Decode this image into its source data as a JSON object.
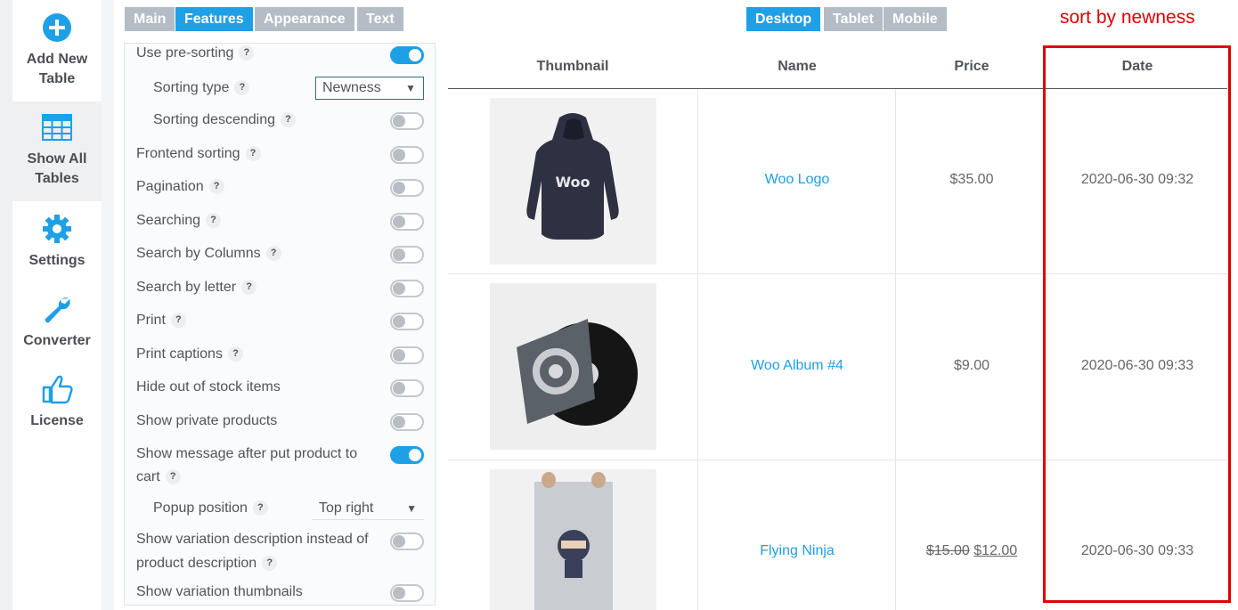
{
  "sidebar": {
    "items": [
      {
        "label": "Add New\nTable",
        "icon": "plus-circle-icon"
      },
      {
        "label": "Show All\nTables",
        "icon": "table-icon"
      },
      {
        "label": "Settings",
        "icon": "gear-icon"
      },
      {
        "label": "Converter",
        "icon": "wrench-icon"
      },
      {
        "label": "License",
        "icon": "thumbs-up-icon"
      }
    ]
  },
  "tabs": [
    "Main",
    "Features",
    "Appearance",
    "Text"
  ],
  "active_tab": "Features",
  "device_tabs": [
    "Desktop",
    "Tablet",
    "Mobile"
  ],
  "active_device": "Desktop",
  "settings": {
    "use_presorting": {
      "label": "Use pre-sorting",
      "on": true
    },
    "sorting_type": {
      "label": "Sorting type",
      "value": "Newness"
    },
    "sorting_descending": {
      "label": "Sorting descending",
      "on": false
    },
    "frontend_sorting": {
      "label": "Frontend sorting",
      "on": false
    },
    "pagination": {
      "label": "Pagination",
      "on": false
    },
    "searching": {
      "label": "Searching",
      "on": false
    },
    "search_by_columns": {
      "label": "Search by Columns",
      "on": false
    },
    "search_by_letter": {
      "label": "Search by letter",
      "on": false
    },
    "print": {
      "label": "Print",
      "on": false
    },
    "print_captions": {
      "label": "Print captions",
      "on": false
    },
    "hide_out_of_stock": {
      "label": "Hide out of stock items",
      "on": false
    },
    "show_private_products": {
      "label": "Show private products",
      "on": false
    },
    "show_message_cart": {
      "label_line1": "Show message after put product to",
      "label_line2": "cart",
      "on": true
    },
    "popup_position": {
      "label": "Popup position",
      "value": "Top right"
    },
    "show_variation_description": {
      "label_line1": "Show variation description instead of",
      "label_line2": "product description",
      "on": false
    },
    "show_variation_thumbnails": {
      "label": "Show variation thumbnails",
      "on": false
    },
    "help_glyph": "?",
    "dropdown_arrow": "▼"
  },
  "table": {
    "headers": [
      "Thumbnail",
      "Name",
      "Price",
      "Date"
    ],
    "rows": [
      {
        "name": "Woo Logo",
        "price": "$35.00",
        "date": "2020-06-30 09:32"
      },
      {
        "name": "Woo Album #4",
        "price": "$9.00",
        "date": "2020-06-30 09:33"
      },
      {
        "name": "Flying Ninja",
        "price_old": "$15.00",
        "price_new": "$12.00",
        "date": "2020-06-30 09:33"
      }
    ]
  },
  "annotation": {
    "text": "sort by newness",
    "color": "#e00000"
  },
  "colors": {
    "accent": "#1ea0e6",
    "tab_inactive": "#b4bcc6",
    "annotation": "#e00000"
  }
}
